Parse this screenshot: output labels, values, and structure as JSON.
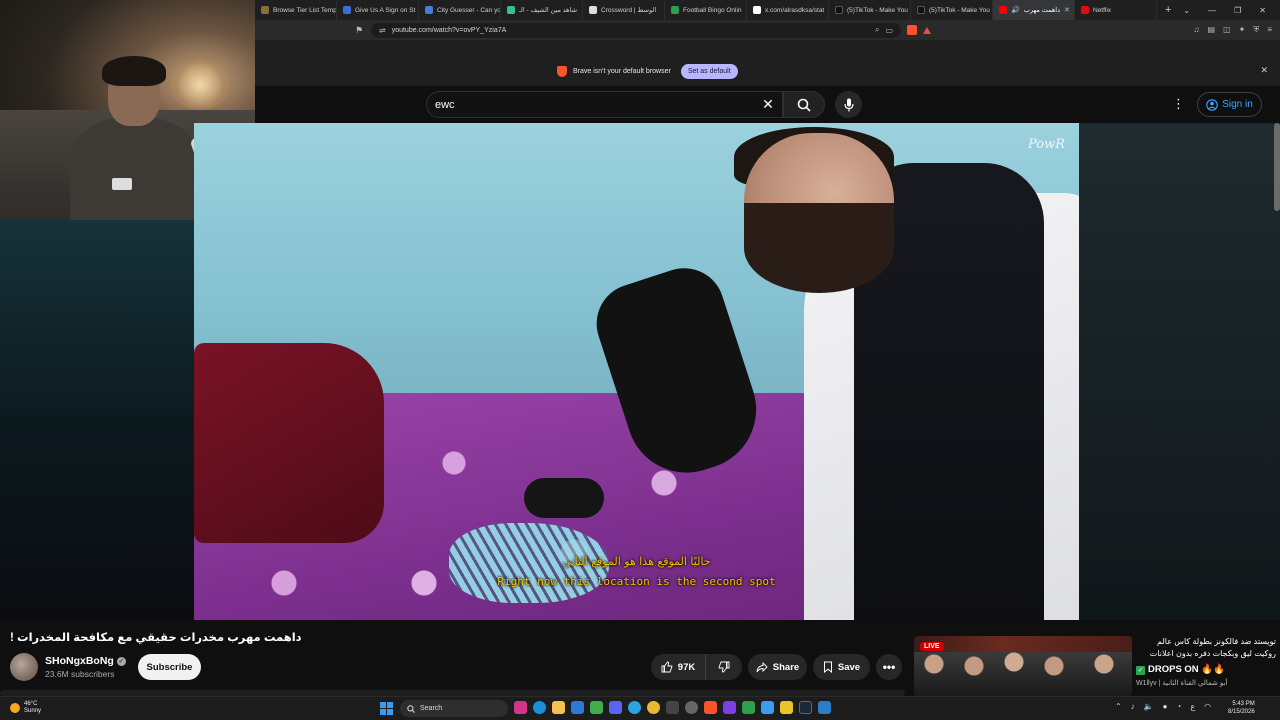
{
  "browser": {
    "tabs": [
      {
        "label": "Browse Tier List Temp",
        "color": "#8a6d3b"
      },
      {
        "label": "Give Us A Sign on St",
        "color": "#3b6fd8"
      },
      {
        "label": "City Guesser - Can yo",
        "color": "#4a7bd8"
      },
      {
        "label": "شاهد مين الشيف - الـ",
        "color": "#37c08c"
      },
      {
        "label": "Crossword | الوسط",
        "color": "#dddddd"
      },
      {
        "label": "Football Bingo Onlin",
        "color": "#2e9e4f"
      },
      {
        "label": "x.com/alrasdksa/stat",
        "color": "#ffffff"
      },
      {
        "label": "(5)TikTok - Make You",
        "color": "#111111"
      },
      {
        "label": "(5)TikTok - Make You",
        "color": "#111111"
      },
      {
        "label": "داهمت مهرب",
        "color": "#ff0000"
      },
      {
        "label": "Netflix",
        "color": "#e50914"
      }
    ],
    "active_tab_index": 9,
    "url": "youtube.com/watch?v=ovPY_Yzia7A",
    "notice_text": "Brave isn't your default browser",
    "notice_button": "Set as default"
  },
  "youtube": {
    "search_value": "ewc",
    "signin_label": "Sign in",
    "video": {
      "watermark": "PowR",
      "subtitle_ar": "حاليًا الموقع هذا هو الموقع الثاني",
      "subtitle_en": "Right now this location is the second spot"
    },
    "title": "داهمت مهرب مخدرات حقيقي مع مكافحة المخدرات !",
    "channel_name": "SHoNgxBoNg",
    "subscribers": "23.6M subscribers",
    "subscribe_label": "Subscribe",
    "likes": "97K",
    "share_label": "Share",
    "save_label": "Save",
    "ad": {
      "live_label": "LIVE",
      "headline": "تويستد ضد فالكونز بطولة كاس عالم روكيت ليق وبكجات دفره بدون اعلانات",
      "drops": "DROPS ON",
      "meta": "W1llyv | أبو شمالي القناة الثانية"
    }
  },
  "taskbar": {
    "weather_temp": "46°C",
    "weather_desc": "Sunny",
    "search_label": "Search",
    "time": "5:43 PM",
    "date": "8/15/2026"
  }
}
